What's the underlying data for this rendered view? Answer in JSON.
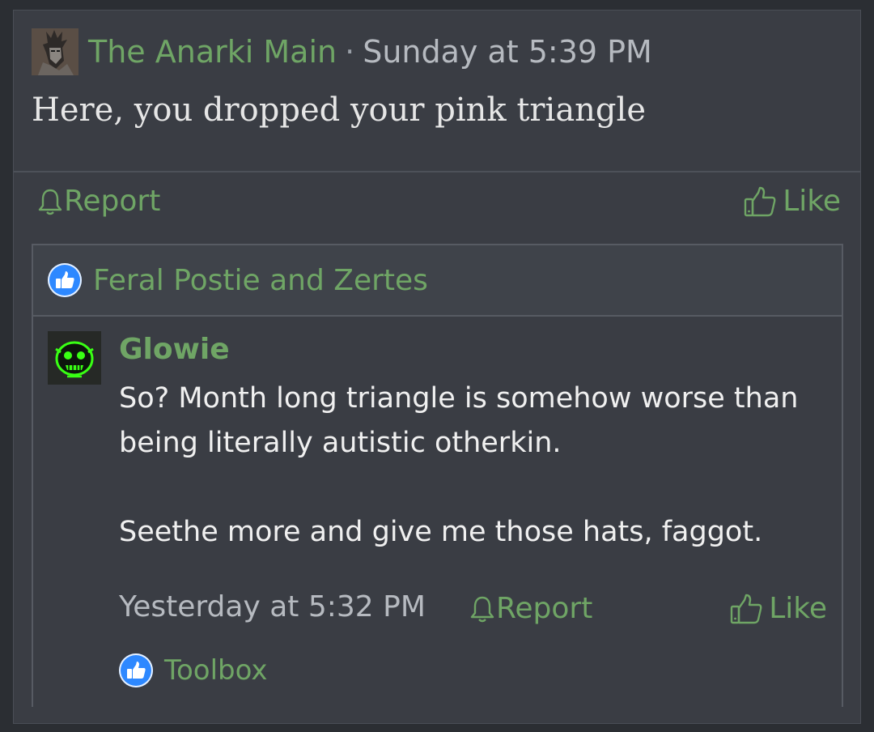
{
  "post": {
    "author": "The Anarki Main",
    "separator": "·",
    "timestamp": "Sunday at 5:39 PM",
    "body": "Here, you dropped your pink triangle",
    "avatar_icon": "user-avatar-icon"
  },
  "post_actions": {
    "report_label": "Report",
    "like_label": "Like"
  },
  "likes": {
    "names": "Feral Postie and Zertes"
  },
  "reply": {
    "author": "Glowie",
    "paragraphs": [
      "So? Month long triangle is somehow worse than being literally autistic otherkin.",
      "Seethe more and give me those hats, faggot."
    ],
    "timestamp": "Yesterday at 5:32 PM",
    "report_label": "Report",
    "like_label": "Like",
    "likes_names": "Toolbox"
  },
  "colors": {
    "background": "#2b2e33",
    "panel": "#3a3d44",
    "accent_green": "#6fa565",
    "like_blue": "#2d88ff",
    "muted_text": "#b6bac0",
    "body_text": "#e6e6e6"
  }
}
